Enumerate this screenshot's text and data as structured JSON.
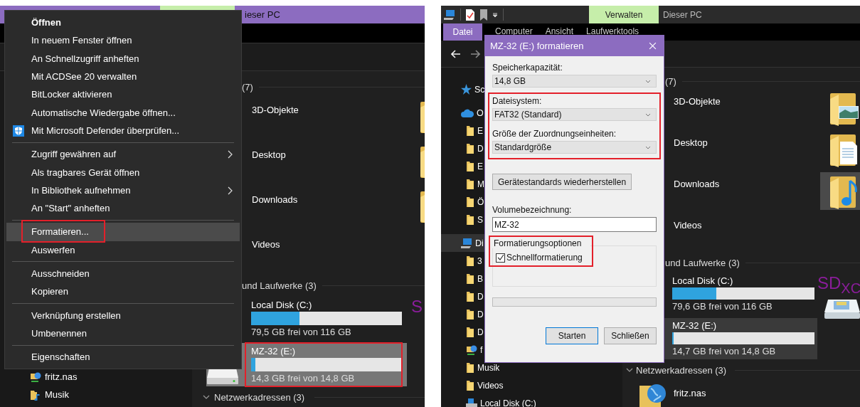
{
  "left": {
    "title_bar": {
      "location": "ieser PC"
    },
    "sidebar_items": [
      {
        "label": "fritz.nas",
        "kind": "network"
      },
      {
        "label": "Musik",
        "kind": "folder"
      }
    ],
    "folders_header": "(7)",
    "folders": [
      {
        "name": "3D-Objekte"
      },
      {
        "name": "Desktop"
      },
      {
        "name": "Downloads"
      },
      {
        "name": "Videos"
      }
    ],
    "drives_header": "und Laufwerke (3)",
    "drives": [
      {
        "name": "Local Disk (C:)",
        "level": 0.32,
        "free": "79,5 GB frei von 116 GB",
        "selected": false,
        "highlighted": false
      },
      {
        "name": "MZ-32 (E:)",
        "level": 0.03,
        "free": "14,3 GB frei von 14,8 GB",
        "selected": true,
        "highlighted": true
      }
    ],
    "sd_card": {
      "label": "S"
    },
    "network_header": "Netzwerkadressen (3)",
    "context_menu": [
      {
        "kind": "item",
        "label": "Öffnen",
        "bold": true,
        "selected": false,
        "highlighted": false
      },
      {
        "kind": "item",
        "label": "In neuem Fenster öffnen",
        "bold": false,
        "selected": false,
        "highlighted": false
      },
      {
        "kind": "item",
        "label": "An Schnellzugriff anheften",
        "bold": false,
        "selected": false,
        "highlighted": false
      },
      {
        "kind": "item",
        "label": "Mit ACDSee 20 verwalten",
        "bold": false,
        "selected": false,
        "highlighted": false
      },
      {
        "kind": "item",
        "label": "BitLocker aktivieren",
        "bold": false,
        "selected": false,
        "highlighted": false
      },
      {
        "kind": "item",
        "label": "Automatische Wiedergabe öffnen...",
        "bold": false,
        "selected": false,
        "highlighted": false
      },
      {
        "kind": "icon_item",
        "label": "Mit Microsoft Defender überprüfen...",
        "bold": false,
        "selected": false,
        "highlighted": false
      },
      {
        "kind": "separator"
      },
      {
        "kind": "submenu_item",
        "label": "Zugriff gewähren auf",
        "bold": false,
        "selected": false,
        "highlighted": false
      },
      {
        "kind": "item",
        "label": "Als tragbares Gerät öffnen",
        "bold": false,
        "selected": false,
        "highlighted": false
      },
      {
        "kind": "submenu_item",
        "label": "In Bibliothek aufnehmen",
        "bold": false,
        "selected": false,
        "highlighted": false
      },
      {
        "kind": "item",
        "label": "An \"Start\" anheften",
        "bold": false,
        "selected": false,
        "highlighted": false
      },
      {
        "kind": "separator"
      },
      {
        "kind": "item",
        "label": "Formatieren...",
        "bold": false,
        "selected": true,
        "highlighted": true
      },
      {
        "kind": "item",
        "label": "Auswerfen",
        "bold": false,
        "selected": false,
        "highlighted": false
      },
      {
        "kind": "separator"
      },
      {
        "kind": "item",
        "label": "Ausschneiden",
        "bold": false,
        "selected": false,
        "highlighted": false
      },
      {
        "kind": "item",
        "label": "Kopieren",
        "bold": false,
        "selected": false,
        "highlighted": false
      },
      {
        "kind": "separator"
      },
      {
        "kind": "item",
        "label": "Verknüpfung erstellen",
        "bold": false,
        "selected": false,
        "highlighted": false
      },
      {
        "kind": "item",
        "label": "Umbenennen",
        "bold": false,
        "selected": false,
        "highlighted": false
      },
      {
        "kind": "separator"
      },
      {
        "kind": "item",
        "label": "Eigenschaften",
        "bold": false,
        "selected": false,
        "highlighted": false
      }
    ]
  },
  "right": {
    "title_bar": {
      "tool_tab": "Verwalten",
      "location": "Dieser PC"
    },
    "ribbon_tabs": [
      {
        "label": "Datei",
        "selected": true
      },
      {
        "label": "Computer",
        "selected": false
      },
      {
        "label": "Ansicht",
        "selected": false
      },
      {
        "label": "Laufwerktools",
        "selected": false
      }
    ],
    "sidebar": [
      {
        "label": "Sc",
        "selected": false
      },
      {
        "label": "O",
        "selected": false,
        "children": [
          {
            "label": "E",
            "kind": "folder",
            "selected": false
          },
          {
            "label": "D",
            "kind": "folder",
            "selected": false
          },
          {
            "label": "E",
            "kind": "folder",
            "selected": false
          },
          {
            "label": "M",
            "kind": "folder",
            "selected": false
          },
          {
            "label": "Ö",
            "kind": "folder",
            "selected": false
          },
          {
            "label": "S",
            "kind": "folder",
            "selected": false
          }
        ]
      },
      {
        "label": "Di",
        "selected": true,
        "children": [
          {
            "label": "3",
            "kind": "folder",
            "selected": false
          },
          {
            "label": "B",
            "kind": "folder",
            "selected": false
          },
          {
            "label": "D",
            "kind": "folder",
            "selected": false
          },
          {
            "label": "D",
            "kind": "folder",
            "selected": false
          },
          {
            "label": "D",
            "kind": "folder",
            "selected": false
          },
          {
            "label": "f",
            "kind": "network",
            "selected": false
          },
          {
            "label": "Musik",
            "kind": "folder",
            "selected": false
          },
          {
            "label": "Videos",
            "kind": "folder",
            "selected": false
          },
          {
            "label": "Local Disk (C:)",
            "kind": "drive",
            "selected": false
          }
        ]
      }
    ],
    "folders_header": "(7)",
    "folders": [
      {
        "name": "3D-Objekte"
      },
      {
        "name": "Desktop"
      },
      {
        "name": "Downloads"
      },
      {
        "name": "Videos"
      }
    ],
    "next_column_tiles": [
      {
        "selected": false
      },
      {
        "selected": false
      },
      {
        "selected": true
      }
    ],
    "drives_header": "und Laufwerke (3)",
    "drives": [
      {
        "name": "Local Disk (C:)",
        "level": 0.31,
        "free": "79,6 GB frei von 116 GB",
        "selected": false
      },
      {
        "name": "MZ-32 (E:)",
        "level": 0.01,
        "free": "14,7 GB frei von 14,8 GB",
        "selected": true
      }
    ],
    "sd_card": {
      "label": "SD$_{XC}$"
    },
    "network_header": "Netzwerkadressen (3)",
    "network_items": [
      {
        "name": "fritz.nas"
      }
    ],
    "format_dialog": {
      "title": "MZ-32 (E:) formatieren",
      "fields": [
        {
          "label": "Speicherkapazität:",
          "value": "14,8 GB",
          "highlighted": false
        },
        {
          "label": "Dateisystem:",
          "value": "FAT32 (Standard)",
          "highlighted": true
        },
        {
          "label": "Größe der Zuordnungseinheiten:",
          "value": "Standardgröße",
          "highlighted": true
        }
      ],
      "restore_button": "Gerätestandards wiederherstellen",
      "volume_label": "Volumebezeichnung:",
      "volume_value": "MZ-32",
      "options_title": "Formatierungsoptionen",
      "options_highlighted": true,
      "quick_format": {
        "label": "Schnellformatierung",
        "checked": true
      },
      "progress": {
        "level": 0
      },
      "buttons": [
        {
          "label": "Starten",
          "default": true
        },
        {
          "label": "Schließen",
          "default": false
        }
      ]
    }
  }
}
